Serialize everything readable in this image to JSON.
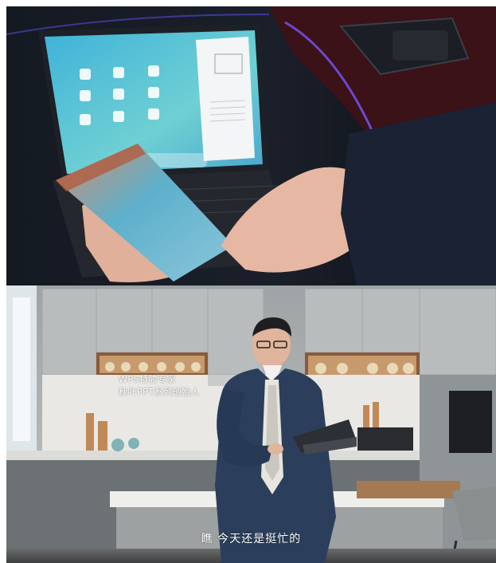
{
  "captions": {
    "title_line_1": "WPS特聘专家",
    "title_line_2": "秋叶PPT系列创始人",
    "subtitle": "瞧 今天还是挺忙的"
  },
  "colors": {
    "tablet_screen": "#5fc9d6",
    "suit": "#2b3f5c",
    "kitchen_cabinet": "#b9bcbd",
    "counter": "#e9e9e6"
  }
}
